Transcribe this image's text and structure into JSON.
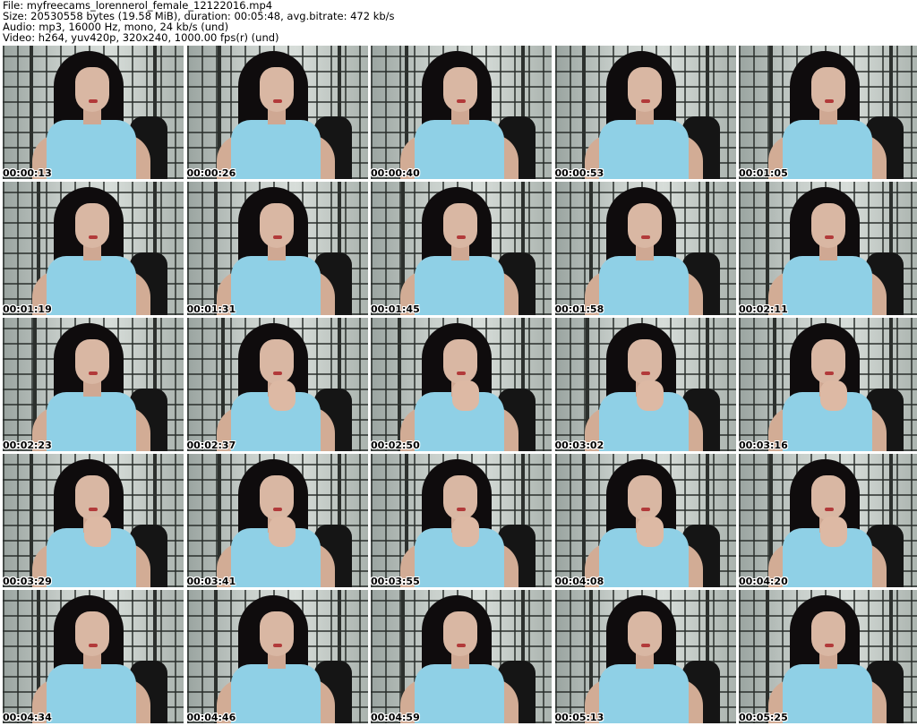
{
  "header": {
    "file_line": "File: myfreecams_lorennerol_female_12122016.mp4",
    "size_line": "Size: 20530558 bytes (19.58 MiB), duration: 00:05:48, avg.bitrate: 472 kb/s",
    "audio_line": "Audio: mp3, 16000 Hz, mono, 24 kb/s (und)",
    "video_line": "Video: h264, yuv420p, 320x240, 1000.00 fps(r) (und)"
  },
  "thumbnails": [
    {
      "time": "00:00:13",
      "pose": "upright"
    },
    {
      "time": "00:00:26",
      "pose": "upright"
    },
    {
      "time": "00:00:40",
      "pose": "upright"
    },
    {
      "time": "00:00:53",
      "pose": "upright"
    },
    {
      "time": "00:01:05",
      "pose": "upright"
    },
    {
      "time": "00:01:19",
      "pose": "upright"
    },
    {
      "time": "00:01:31",
      "pose": "upright"
    },
    {
      "time": "00:01:45",
      "pose": "upright"
    },
    {
      "time": "00:01:58",
      "pose": "upright"
    },
    {
      "time": "00:02:11",
      "pose": "upright"
    },
    {
      "time": "00:02:23",
      "pose": "upright"
    },
    {
      "time": "00:02:37",
      "pose": "lean"
    },
    {
      "time": "00:02:50",
      "pose": "lean"
    },
    {
      "time": "00:03:02",
      "pose": "lean"
    },
    {
      "time": "00:03:16",
      "pose": "lean"
    },
    {
      "time": "00:03:29",
      "pose": "lean"
    },
    {
      "time": "00:03:41",
      "pose": "lean"
    },
    {
      "time": "00:03:55",
      "pose": "lean"
    },
    {
      "time": "00:04:08",
      "pose": "lean"
    },
    {
      "time": "00:04:20",
      "pose": "lean"
    },
    {
      "time": "00:04:34",
      "pose": "upright"
    },
    {
      "time": "00:04:46",
      "pose": "upright"
    },
    {
      "time": "00:04:59",
      "pose": "upright"
    },
    {
      "time": "00:05:13",
      "pose": "upright"
    },
    {
      "time": "00:05:25",
      "pose": "upright"
    }
  ]
}
